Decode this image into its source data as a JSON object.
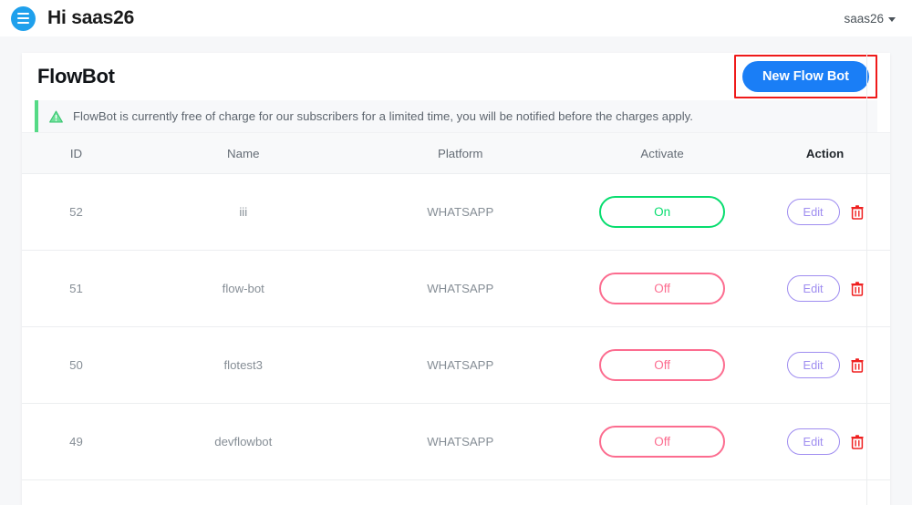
{
  "topbar": {
    "menu_icon": "hamburger-icon",
    "greeting": "Hi saas26",
    "account_label": "saas26",
    "caret_icon": "chevron-down-icon",
    "brand_color": "#1fa0ec"
  },
  "card": {
    "title": "FlowBot",
    "new_bot_label": "New Flow Bot",
    "new_bot_color": "#1a7ef6",
    "highlight_color": "#ef1a1a"
  },
  "alert": {
    "icon": "warning-triangle-icon",
    "text": "FlowBot is currently free of charge for our subscribers for a limited time, you will be notified before the charges apply.",
    "accent_color": "#55da86"
  },
  "table": {
    "columns": [
      "ID",
      "Name",
      "Platform",
      "Activate",
      "Action"
    ],
    "rows": [
      {
        "id": "52",
        "name": "iii",
        "platform": "WHATSAPP",
        "activate": "On",
        "edit": "Edit",
        "delete_icon": "trash-icon"
      },
      {
        "id": "51",
        "name": "flow-bot",
        "platform": "WHATSAPP",
        "activate": "Off",
        "edit": "Edit",
        "delete_icon": "trash-icon"
      },
      {
        "id": "50",
        "name": "flotest3",
        "platform": "WHATSAPP",
        "activate": "Off",
        "edit": "Edit",
        "delete_icon": "trash-icon"
      },
      {
        "id": "49",
        "name": "devflowbot",
        "platform": "WHATSAPP",
        "activate": "Off",
        "edit": "Edit",
        "delete_icon": "trash-icon"
      }
    ],
    "on_color": "#06dd6e",
    "off_color": "#fc6c8f",
    "edit_color": "#9f8df0",
    "delete_color": "#ef2020"
  }
}
